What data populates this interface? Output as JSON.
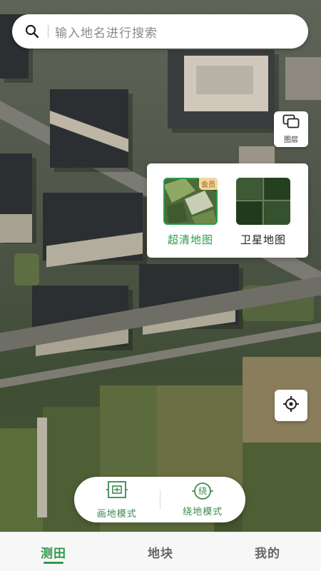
{
  "search": {
    "placeholder": "输入地名进行搜索",
    "icon": "search-icon"
  },
  "layer_button": {
    "label": "图层",
    "icon": "layers-icon"
  },
  "layer_popup": {
    "options": [
      {
        "label": "超清地图",
        "badge": "会员",
        "selected": true
      },
      {
        "label": "卫星地图",
        "selected": false
      }
    ]
  },
  "locate_button": {
    "icon": "crosshair-icon"
  },
  "mode_bar": {
    "draw_label": "画地模式",
    "walk_label": "绕地模式",
    "walk_icon_char": "绕"
  },
  "nav": {
    "tabs": [
      {
        "label": "测田",
        "active": true
      },
      {
        "label": "地块",
        "active": false
      },
      {
        "label": "我的",
        "active": false
      }
    ]
  },
  "colors": {
    "accent": "#2f9a4d",
    "badge_bg": "#f4d79a",
    "nav_bg": "#f7f7f7"
  }
}
